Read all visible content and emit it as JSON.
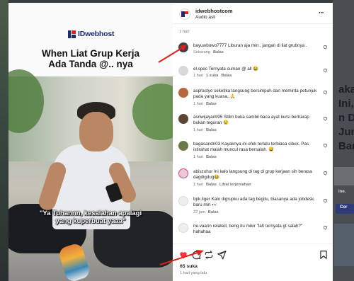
{
  "post": {
    "brand": "IDwebhost",
    "headline_line1": "When Liat Grup Kerja",
    "headline_line2": "Ada Tanda @.. nya",
    "caption_line1": "\"Ya Tuhannn, kesalahan apalagi",
    "caption_line2": "yang kuperbuat yaaa\""
  },
  "header": {
    "username": "idwebhostcom",
    "audio": "Audio asli",
    "more": "···"
  },
  "comments": {
    "previous_meta": "1 hari",
    "reply_label": "Balas",
    "items": [
      {
        "username": "bayuwbowo7777",
        "text": "Liburan aja min , jangan di liat grubnya .",
        "time": "Sekarang",
        "likes": "",
        "extra": ""
      },
      {
        "username": "el.spec",
        "text": "Ternyata cuman @ all 😂",
        "time": "1 hari",
        "likes": "1 suka",
        "extra": ""
      },
      {
        "username": "asprastyo",
        "text": "seketika langsung bersimpuh dan meminta petunjuk pada yang kuasa..🙏",
        "time": "1 hari",
        "likes": "",
        "extra": ""
      },
      {
        "username": "asriwijayanti95",
        "text": "Sblm buka sambil baca ayat kursi berharap bukan teguran 😢",
        "time": "1 hari",
        "likes": "",
        "extra": ""
      },
      {
        "username": "bagasandri03",
        "text": "Kayaknya ini efek terlalu terbiasa sibuk. Pas istirahat malah muncul rasa bersalah. 😅",
        "time": "1 hari",
        "likes": "",
        "extra": ""
      },
      {
        "username": "abiszuhur",
        "text": "Ini kalo langsung di tag di grup kerjaan sih berasa dagdigdug😂",
        "time": "1 hari",
        "likes": "",
        "extra": "Lihat terjemahan"
      },
      {
        "username": "bpk.liger",
        "text": "Kalo digrupku ada tag begitu, biasanya ada jobdesk baru min 👀",
        "time": "22 jam",
        "likes": "",
        "extra": ""
      },
      {
        "username": "rie.vaann",
        "text": "related, beng itu mikir \"lah ternyata gt salah?\" hahahaa",
        "time": "1 hari",
        "likes": "",
        "extra": ""
      }
    ]
  },
  "actions": {
    "likes": "65 suka",
    "time": "1 hari yang lalu"
  },
  "background_right": {
    "lines": [
      "akalan",
      "Ini,",
      "n Dom",
      "Jum'at",
      "Bange"
    ],
    "small_lines": [
      "ine.",
      "Cor"
    ]
  },
  "colors": {
    "like_red": "#ff3040",
    "brand_blue": "#1d2a6e",
    "annotation_red": "#e0201b"
  }
}
